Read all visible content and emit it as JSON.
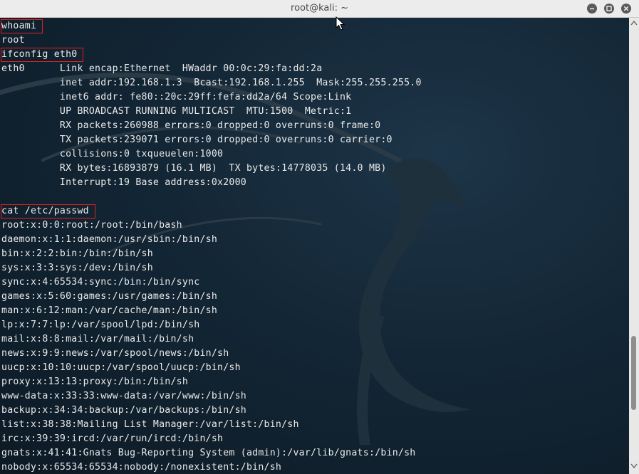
{
  "window": {
    "title": "root@kali: ~"
  },
  "terminal": {
    "lines": [
      {
        "text": "whoami",
        "command": true
      },
      {
        "text": "root",
        "command": false
      },
      {
        "text": "ifconfig eth0",
        "command": true
      },
      {
        "text": "eth0      Link encap:Ethernet  HWaddr 00:0c:29:fa:dd:2a",
        "command": false
      },
      {
        "text": "          inet addr:192.168.1.3  Bcast:192.168.1.255  Mask:255.255.255.0",
        "command": false
      },
      {
        "text": "          inet6 addr: fe80::20c:29ff:fefa:dd2a/64 Scope:Link",
        "command": false
      },
      {
        "text": "          UP BROADCAST RUNNING MULTICAST  MTU:1500  Metric:1",
        "command": false
      },
      {
        "text": "          RX packets:260988 errors:0 dropped:0 overruns:0 frame:0",
        "command": false
      },
      {
        "text": "          TX packets:239071 errors:0 dropped:0 overruns:0 carrier:0",
        "command": false
      },
      {
        "text": "          collisions:0 txqueuelen:1000",
        "command": false
      },
      {
        "text": "          RX bytes:16893879 (16.1 MB)  TX bytes:14778035 (14.0 MB)",
        "command": false
      },
      {
        "text": "          Interrupt:19 Base address:0x2000",
        "command": false
      },
      {
        "text": "",
        "command": false
      },
      {
        "text": "cat /etc/passwd",
        "command": true
      },
      {
        "text": "root:x:0:0:root:/root:/bin/bash",
        "command": false
      },
      {
        "text": "daemon:x:1:1:daemon:/usr/sbin:/bin/sh",
        "command": false
      },
      {
        "text": "bin:x:2:2:bin:/bin:/bin/sh",
        "command": false
      },
      {
        "text": "sys:x:3:3:sys:/dev:/bin/sh",
        "command": false
      },
      {
        "text": "sync:x:4:65534:sync:/bin:/bin/sync",
        "command": false
      },
      {
        "text": "games:x:5:60:games:/usr/games:/bin/sh",
        "command": false
      },
      {
        "text": "man:x:6:12:man:/var/cache/man:/bin/sh",
        "command": false
      },
      {
        "text": "lp:x:7:7:lp:/var/spool/lpd:/bin/sh",
        "command": false
      },
      {
        "text": "mail:x:8:8:mail:/var/mail:/bin/sh",
        "command": false
      },
      {
        "text": "news:x:9:9:news:/var/spool/news:/bin/sh",
        "command": false
      },
      {
        "text": "uucp:x:10:10:uucp:/var/spool/uucp:/bin/sh",
        "command": false
      },
      {
        "text": "proxy:x:13:13:proxy:/bin:/bin/sh",
        "command": false
      },
      {
        "text": "www-data:x:33:33:www-data:/var/www:/bin/sh",
        "command": false
      },
      {
        "text": "backup:x:34:34:backup:/var/backups:/bin/sh",
        "command": false
      },
      {
        "text": "list:x:38:38:Mailing List Manager:/var/list:/bin/sh",
        "command": false
      },
      {
        "text": "irc:x:39:39:ircd:/var/run/ircd:/bin/sh",
        "command": false
      },
      {
        "text": "gnats:x:41:41:Gnats Bug-Reporting System (admin):/var/lib/gnats:/bin/sh",
        "command": false
      },
      {
        "text": "nobody:x:65534:65534:nobody:/nonexistent:/bin/sh",
        "command": false
      }
    ]
  },
  "colors": {
    "terminal_background": "#132635",
    "terminal_text": "#eaeaea",
    "command_highlight": "#e02020",
    "titlebar": "#ececec"
  },
  "icons": {
    "minimize": "minimize-icon",
    "maximize": "maximize-icon",
    "close": "close-icon",
    "wallpaper": "kali-dragon-logo"
  }
}
